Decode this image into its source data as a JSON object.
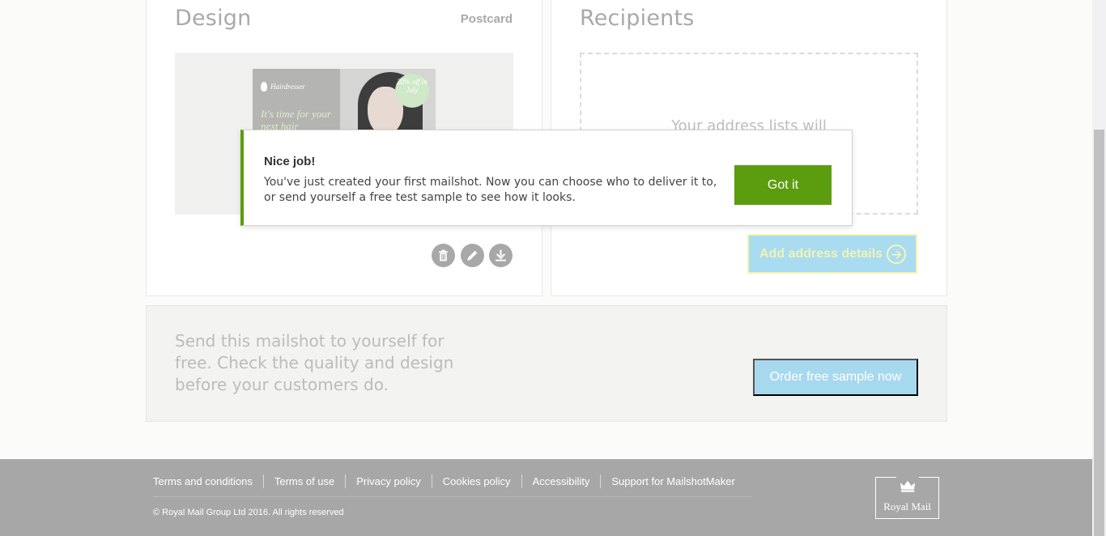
{
  "design": {
    "title": "Design",
    "format": "Postcard",
    "preview": {
      "brand": "Hairdresser",
      "tagline": "It's time for your next hair",
      "badge": "20% off in July"
    }
  },
  "recipients": {
    "title": "Recipients",
    "placeholder_text": "Your address lists will",
    "add_address_label": "Add address details"
  },
  "sample": {
    "text": "Send this mailshot to yourself for free. Check the quality and design before your customers do.",
    "button_label": "Order free sample now"
  },
  "dialog": {
    "title": "Nice job!",
    "body": "You've just created your first mailshot. Now you can choose who to deliver it to, or send yourself a free test sample to see how it looks.",
    "button_label": "Got it"
  },
  "footer": {
    "links": [
      "Terms and conditions",
      "Terms of use",
      "Privacy policy",
      "Cookies policy",
      "Accessibility",
      "Support for MailshotMaker"
    ],
    "copyright": "© Royal Mail Group Ltd 2016. All rights reserved",
    "logo_text": "Royal Mail"
  },
  "colors": {
    "accent_green": "#5c9d10",
    "button_blue": "#a7d9ee",
    "footer_grey": "#a7a7a7"
  },
  "icons": {
    "delete": "trash-icon",
    "edit": "pencil-icon",
    "download": "download-icon",
    "arrow": "arrow-right-icon",
    "logo": "royal-mail-crown-icon"
  }
}
